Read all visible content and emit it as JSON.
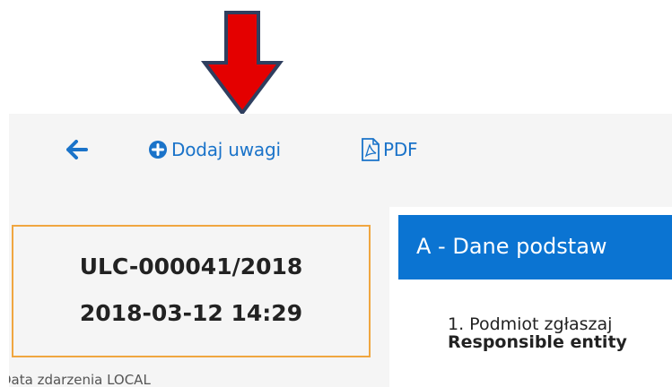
{
  "toolbar": {
    "back_icon": "arrow-left-icon",
    "add_notes_label": "Dodaj uwagi",
    "add_notes_icon": "plus-circle-icon",
    "pdf_label": "PDF",
    "pdf_icon": "file-pdf-icon"
  },
  "record": {
    "number": "ULC-000041/2018",
    "datetime": "2018-03-12 14:29",
    "event_date_label": "Data zdarzenia LOCAL"
  },
  "section": {
    "title": "A - Dane podstaw",
    "field_1_label": "1. Podmiot zgłaszaj",
    "field_1_label_en": "Responsible entity"
  },
  "colors": {
    "accent_blue": "#1a73c9",
    "header_blue": "#0b74d2",
    "card_border": "#f0a640",
    "annotation_arrow": "#e00000"
  }
}
